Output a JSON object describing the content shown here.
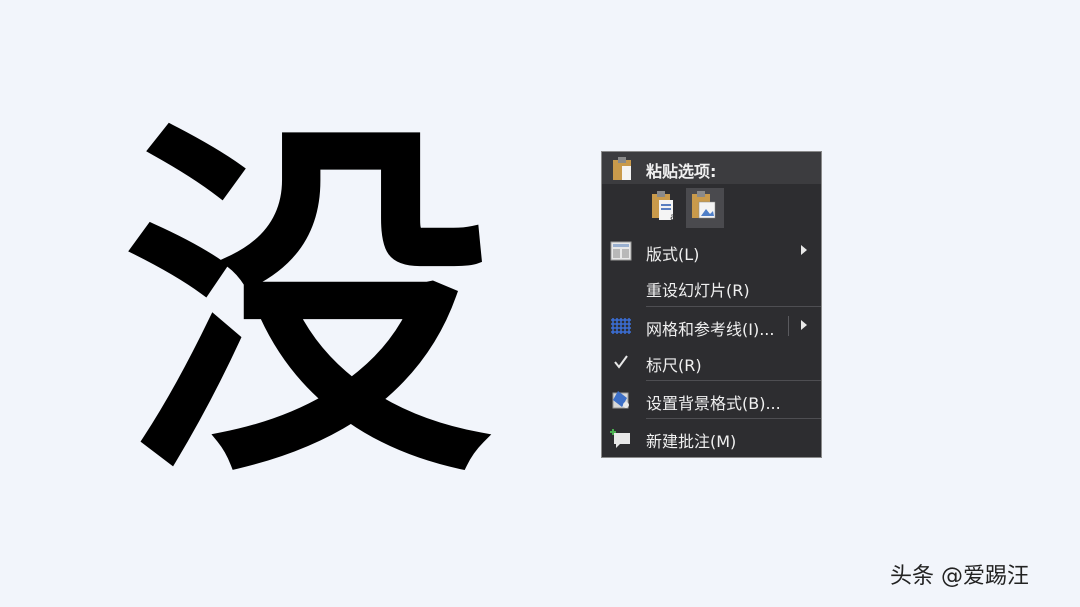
{
  "slide": {
    "character": "没"
  },
  "menu": {
    "header": "粘贴选项:",
    "items": [
      {
        "label": "版式(L)",
        "icon": "layout-icon"
      },
      {
        "label": "重设幻灯片(R)",
        "icon": ""
      },
      {
        "label": "网格和参考线(I)...",
        "icon": "grid-icon"
      },
      {
        "label": "标尺(R)",
        "icon": "checkmark-icon"
      },
      {
        "label": "设置背景格式(B)...",
        "icon": "background-format-icon"
      },
      {
        "label": "新建批注(M)",
        "icon": "new-comment-icon"
      }
    ]
  },
  "watermark": "头条 @爱踢汪",
  "colors": {
    "menu_bg": "#2d2d30",
    "menu_header_bg": "#3c3c3f",
    "grid_icon": "#3b6fd6"
  }
}
